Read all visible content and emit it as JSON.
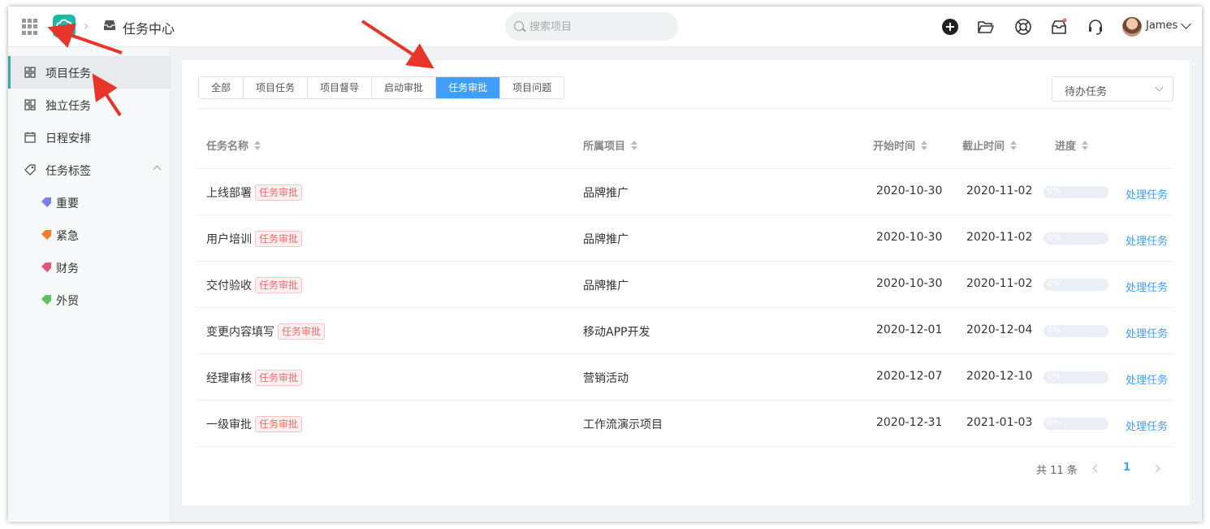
{
  "header": {
    "title": "任务中心",
    "search_placeholder": "搜索项目",
    "user_name": "James",
    "icons": [
      "apps-grid-icon",
      "cloud-logo-icon",
      "inbox-icon",
      "add-circle-icon",
      "folder-open-icon",
      "help-ring-icon",
      "notification-box-icon",
      "headset-icon",
      "chevron-down-icon"
    ],
    "notification_dot_color": "#f56c6c"
  },
  "sidebar": {
    "items": [
      {
        "label": "项目任务",
        "icon": "grid-icon",
        "active": true
      },
      {
        "label": "独立任务",
        "icon": "blocks-icon",
        "active": false
      },
      {
        "label": "日程安排",
        "icon": "calendar-icon",
        "active": false
      },
      {
        "label": "任务标签",
        "icon": "tag-icon",
        "active": false,
        "expanded": true
      }
    ],
    "tags": [
      {
        "label": "重要",
        "color": "#7b7fe8"
      },
      {
        "label": "紧急",
        "color": "#f07c2c"
      },
      {
        "label": "财务",
        "color": "#e05a7c"
      },
      {
        "label": "外贸",
        "color": "#5cc05c"
      }
    ],
    "accent": "#3aa8a8"
  },
  "main": {
    "tabs": [
      "全部",
      "项目任务",
      "项目督导",
      "启动审批",
      "任务审批",
      "项目问题"
    ],
    "active_tab": "任务审批",
    "filter_select": "待办任务",
    "columns": [
      "任务名称",
      "所属项目",
      "开始时间",
      "截止时间",
      "进度"
    ],
    "rows": [
      {
        "name": "上线部署",
        "badge": "任务审批",
        "project": "品牌推广",
        "start": "2020-10-30",
        "end": "2020-11-02",
        "progress": "0%",
        "action": "处理任务"
      },
      {
        "name": "用户培训",
        "badge": "任务审批",
        "project": "品牌推广",
        "start": "2020-10-30",
        "end": "2020-11-02",
        "progress": "0%",
        "action": "处理任务"
      },
      {
        "name": "交付验收",
        "badge": "任务审批",
        "project": "品牌推广",
        "start": "2020-10-30",
        "end": "2020-11-02",
        "progress": "0%",
        "action": "处理任务"
      },
      {
        "name": "变更内容填写",
        "badge": "任务审批",
        "project": "移动APP开发",
        "start": "2020-12-01",
        "end": "2020-12-04",
        "progress": "0%",
        "action": "处理任务"
      },
      {
        "name": "经理审核",
        "badge": "任务审批",
        "project": "营销活动",
        "start": "2020-12-07",
        "end": "2020-12-10",
        "progress": "0%",
        "action": "处理任务"
      },
      {
        "name": "一级审批",
        "badge": "任务审批",
        "project": "工作流演示项目",
        "start": "2020-12-31",
        "end": "2021-01-03",
        "progress": "0%",
        "action": "处理任务"
      }
    ],
    "pagination": {
      "total": "共 11 条",
      "current": "1"
    },
    "accent": "#409eff",
    "badge_color": "#f56c6c"
  }
}
